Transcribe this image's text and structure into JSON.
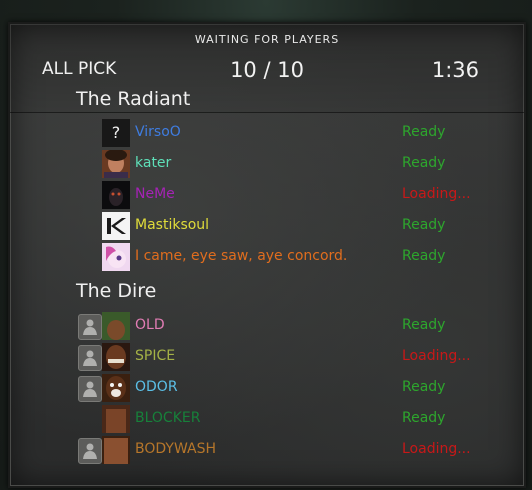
{
  "header": {
    "title": "WAITING FOR PLAYERS",
    "mode": "ALL PICK",
    "count": "10 / 10",
    "timer": "1:36"
  },
  "radiant": {
    "title": "The Radiant",
    "players": [
      {
        "name": "VirsoO",
        "status": "Ready",
        "name_color": "#3f7de0",
        "avatar_icon": "question-mark-icon"
      },
      {
        "name": "kater",
        "status": "Ready",
        "name_color": "#5ee0b8",
        "avatar_icon": "portrait-avatar"
      },
      {
        "name": "NeMe",
        "status": "Loading...",
        "name_color": "#a523b5",
        "avatar_icon": "dark-creature-avatar"
      },
      {
        "name": "Mastiksoul",
        "status": "Ready",
        "name_color": "#e0dc3a",
        "avatar_icon": "k-logo-avatar"
      },
      {
        "name": "I came, eye saw, aye concord.",
        "status": "Ready",
        "name_color": "#e06d1e",
        "avatar_icon": "pony-avatar"
      }
    ]
  },
  "dire": {
    "title": "The Dire",
    "players": [
      {
        "name": "OLD",
        "status": "Ready",
        "name_color": "#e17cb4",
        "avatar_icon": "person-silhouette-icon"
      },
      {
        "name": "SPICE",
        "status": "Loading...",
        "name_color": "#a4b246",
        "avatar_icon": "person-silhouette-icon"
      },
      {
        "name": "ODOR",
        "status": "Ready",
        "name_color": "#5bbfe6",
        "avatar_icon": "person-silhouette-icon"
      },
      {
        "name": "BLOCKER",
        "status": "Ready",
        "name_color": "#17803a",
        "avatar_icon": "none"
      },
      {
        "name": "BODYWASH",
        "status": "Loading...",
        "name_color": "#b6762a",
        "avatar_icon": "person-silhouette-icon"
      }
    ]
  },
  "colors": {
    "ready": "#2da62d",
    "loading": "#c81818"
  }
}
